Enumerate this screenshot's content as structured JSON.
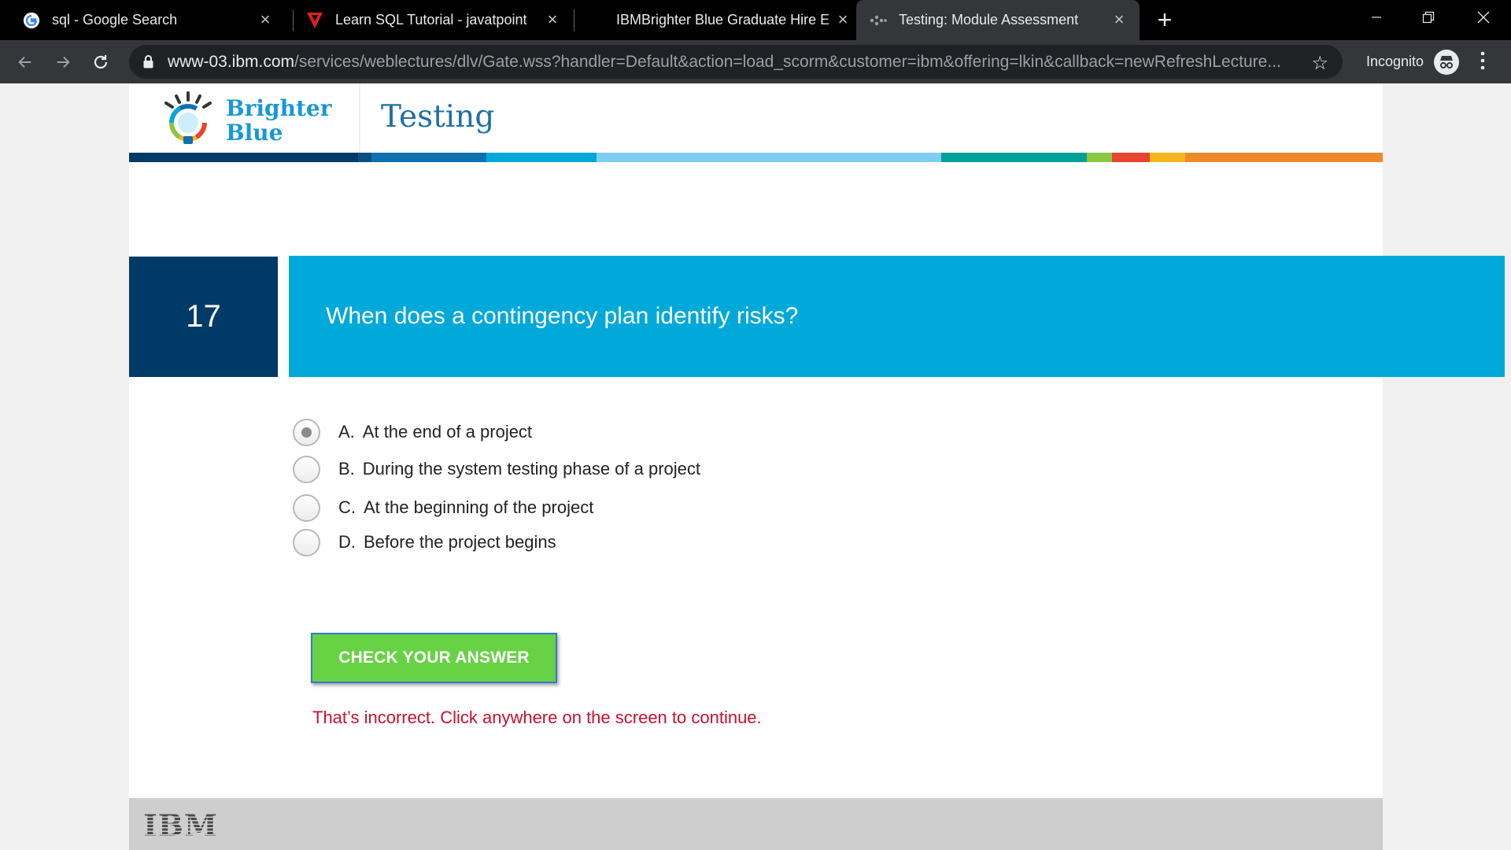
{
  "browser": {
    "tabs": [
      {
        "title": "sql - Google Search",
        "icon": "google-icon",
        "active": false
      },
      {
        "title": "Learn SQL Tutorial - javatpoint",
        "icon": "javatpoint-icon",
        "active": false
      },
      {
        "title": "IBMBrighter Blue Graduate Hire E",
        "icon": "",
        "active": false
      },
      {
        "title": "Testing: Module Assessment",
        "icon": "ibm-loading-icon",
        "active": true
      }
    ],
    "url_host": "www-03.ibm.com",
    "url_path": "/services/weblectures/dlv/Gate.wss?handler=Default&action=load_scorm&customer=ibm&offering=lkin&callback=newRefreshLecture...",
    "incognito_label": "Incognito"
  },
  "header": {
    "logo_line1": "Brighter",
    "logo_line2": "Blue",
    "module_title": "Testing"
  },
  "colors": {
    "bar_segments": [
      "#003a66",
      "#1070b0",
      "#00a9d9",
      "#7fcdf0",
      "#00a098",
      "#8cc63f",
      "#e8442f",
      "#f6b71e",
      "#ee8a2a"
    ],
    "question_bg": "#00a9d9",
    "number_bg": "#003a66",
    "button_bg": "#67d244",
    "feedback": "#c8102e"
  },
  "question": {
    "number": "17",
    "text": "When does a contingency plan identify risks?",
    "options": [
      {
        "letter": "A.",
        "text": "At the end of a project",
        "selected": true
      },
      {
        "letter": "B.",
        "text": "During the system testing phase of a project",
        "selected": false
      },
      {
        "letter": "C.",
        "text": "At the beginning of the project",
        "selected": false
      },
      {
        "letter": "D.",
        "text": "Before the project begins",
        "selected": false
      }
    ],
    "check_label": "CHECK YOUR ANSWER",
    "feedback": "That’s incorrect. Click anywhere on the screen to continue."
  },
  "footer": {
    "logo": "IBM"
  }
}
